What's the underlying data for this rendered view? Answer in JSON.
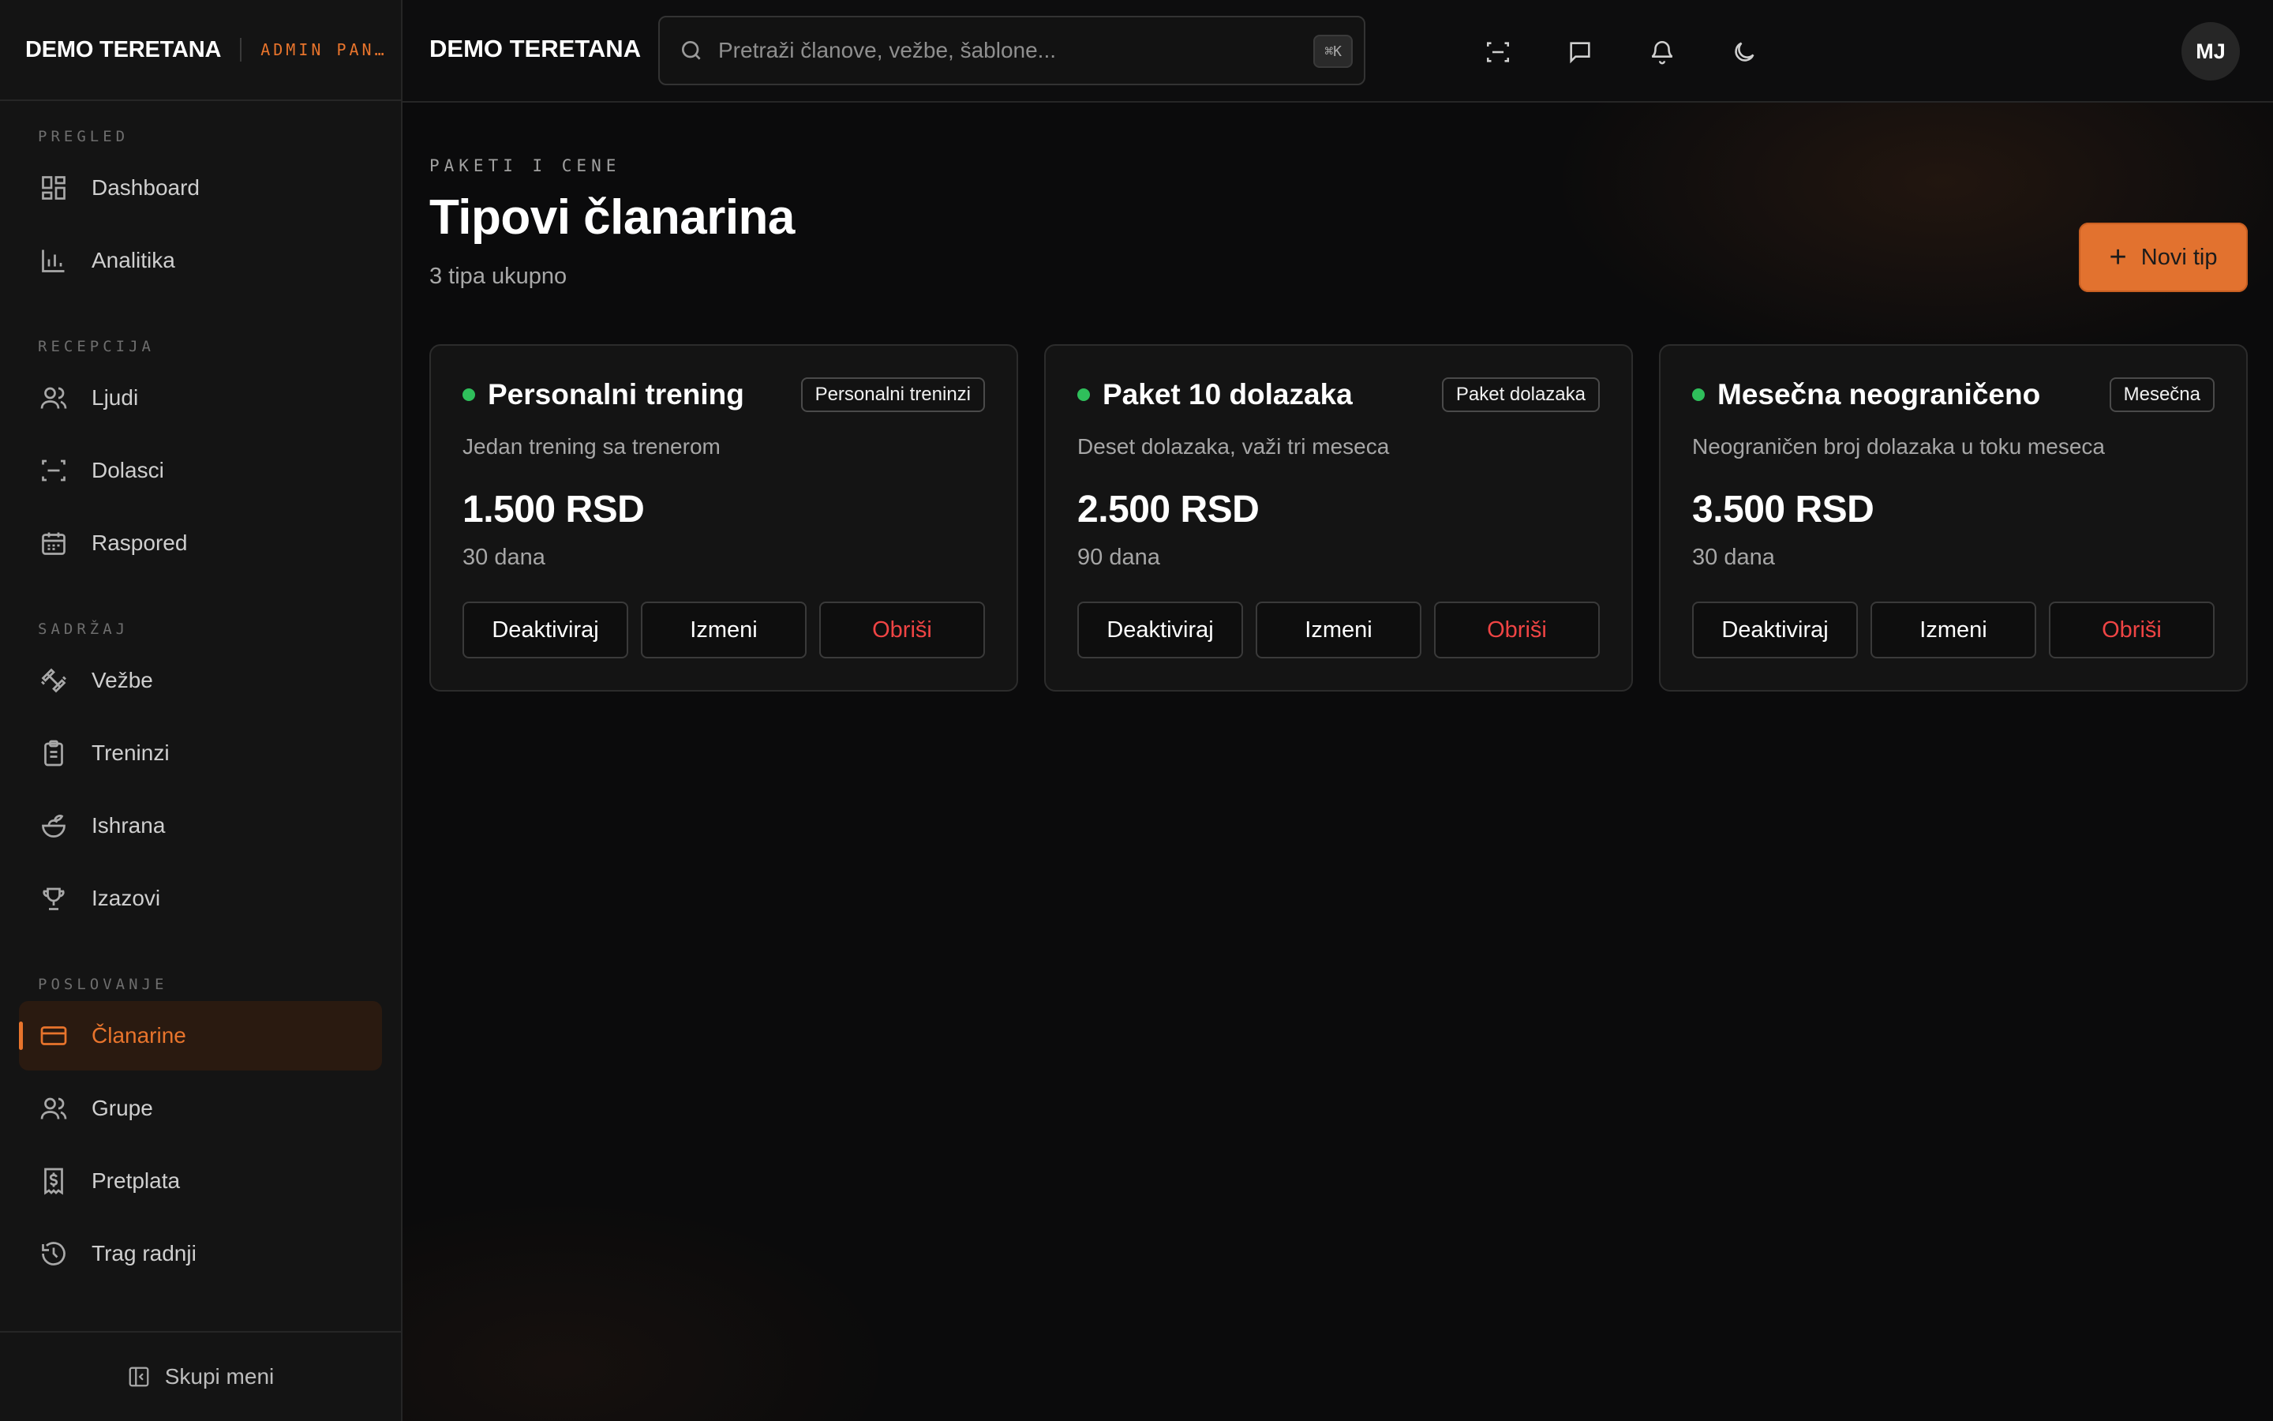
{
  "brand": {
    "name": "DEMO TERETANA",
    "tag": "ADMIN PANEL"
  },
  "sidebar": {
    "sections": [
      {
        "title": "PREGLED",
        "items": [
          {
            "label": "Dashboard",
            "icon": "dashboard-icon"
          },
          {
            "label": "Analitika",
            "icon": "bar-chart-icon"
          }
        ]
      },
      {
        "title": "RECEPCIJA",
        "items": [
          {
            "label": "Ljudi",
            "icon": "users-icon"
          },
          {
            "label": "Dolasci",
            "icon": "scan-icon"
          },
          {
            "label": "Raspored",
            "icon": "calendar-icon"
          }
        ]
      },
      {
        "title": "SADRŽAJ",
        "items": [
          {
            "label": "Vežbe",
            "icon": "dumbbell-icon"
          },
          {
            "label": "Treninzi",
            "icon": "clipboard-icon"
          },
          {
            "label": "Ishrana",
            "icon": "salad-icon"
          },
          {
            "label": "Izazovi",
            "icon": "trophy-icon"
          }
        ]
      },
      {
        "title": "POSLOVANJE",
        "items": [
          {
            "label": "Članarine",
            "icon": "credit-card-icon",
            "active": true
          },
          {
            "label": "Grupe",
            "icon": "users-icon"
          },
          {
            "label": "Pretplata",
            "icon": "receipt-icon"
          },
          {
            "label": "Trag radnji",
            "icon": "history-icon"
          }
        ]
      }
    ],
    "collapse_label": "Skupi meni"
  },
  "topbar": {
    "title": "DEMO TERETANA",
    "search_placeholder": "Pretraži članove, vežbe, šablone...",
    "search_shortcut": "⌘K",
    "avatar_initials": "MJ"
  },
  "page": {
    "eyebrow": "PAKETI I CENE",
    "title": "Tipovi članarina",
    "subtitle": "3 tipa ukupno",
    "new_button": "Novi tip"
  },
  "cards": [
    {
      "title": "Personalni trening",
      "badge": "Personalni treninzi",
      "description": "Jedan trening sa trenerom",
      "price": "1.500 RSD",
      "duration": "30 dana",
      "deactivate": "Deaktiviraj",
      "edit": "Izmeni",
      "delete": "Obriši"
    },
    {
      "title": "Paket 10 dolazaka",
      "badge": "Paket dolazaka",
      "description": "Deset dolazaka, važi tri meseca",
      "price": "2.500 RSD",
      "duration": "90 dana",
      "deactivate": "Deaktiviraj",
      "edit": "Izmeni",
      "delete": "Obriši"
    },
    {
      "title": "Mesečna neograničeno",
      "badge": "Mesečna",
      "description": "Neograničen broj dolazaka u toku meseca",
      "price": "3.500 RSD",
      "duration": "30 dana",
      "deactivate": "Deaktiviraj",
      "edit": "Izmeni",
      "delete": "Obriši"
    }
  ],
  "colors": {
    "accent": "#e8742c",
    "active_dot": "#2fbf5b",
    "danger": "#ef4444"
  }
}
